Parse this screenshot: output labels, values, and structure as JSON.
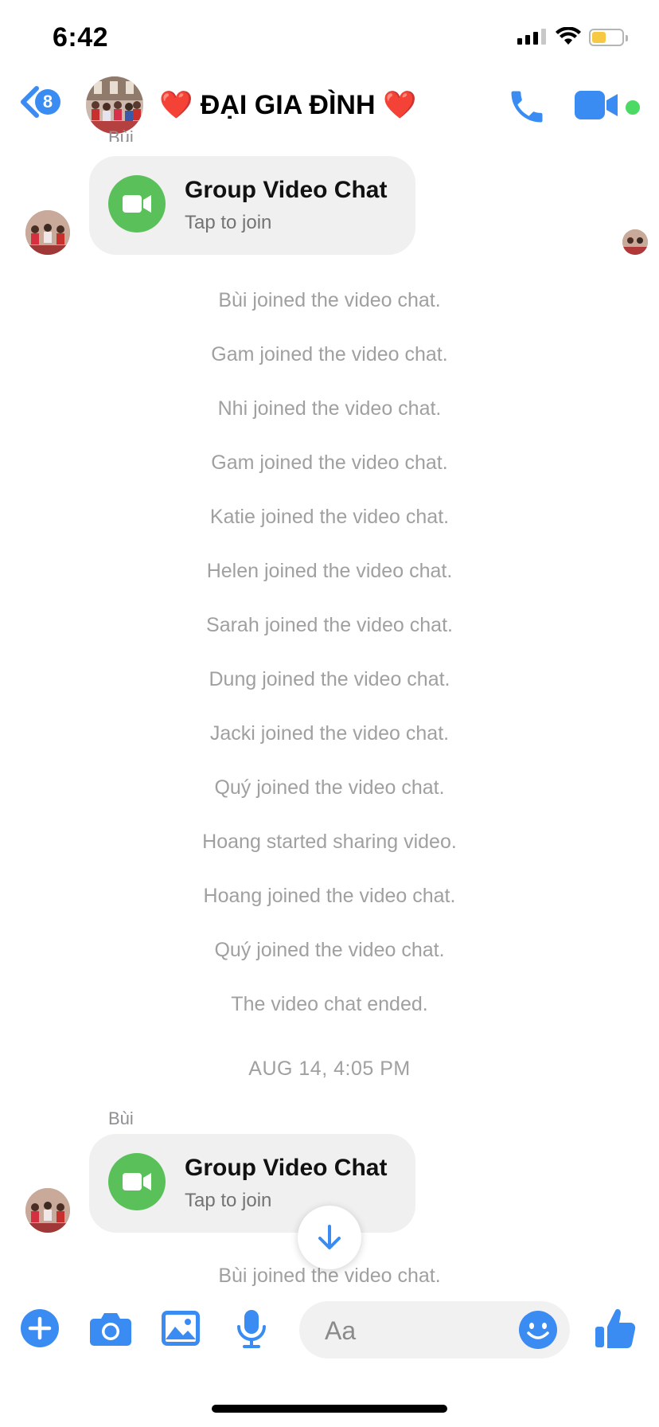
{
  "status_bar": {
    "time": "6:42"
  },
  "header": {
    "unread_count": "8",
    "title_heart_left": "❤️",
    "title": "ĐẠI GIA ĐÌNH",
    "title_heart_right": "❤️",
    "active": true
  },
  "messages": {
    "first_card": {
      "sender": "Bùi",
      "title": "Group Video Chat",
      "subtitle": "Tap to join"
    },
    "system_messages": [
      "Bùi joined the video chat.",
      "Gam joined the video chat.",
      "Nhi joined the video chat.",
      "Gam joined the video chat.",
      "Katie joined the video chat.",
      "Helen joined the video chat.",
      "Sarah joined the video chat.",
      "Dung joined the video chat.",
      "Jacki joined the video chat.",
      "Quý joined the video chat.",
      "Hoang started sharing video.",
      "Hoang joined the video chat.",
      "Quý joined the video chat.",
      "The video chat ended."
    ],
    "date_separator": "AUG 14, 4:05 PM",
    "second_card": {
      "sender": "Bùi",
      "title": "Group Video Chat",
      "subtitle": "Tap to join"
    },
    "last_system_message": "Bùi joined the video chat."
  },
  "composer": {
    "placeholder": "Aa"
  },
  "colors": {
    "accent": "#3a8cf2",
    "video_green": "#5ac05a",
    "active_green": "#4cd964",
    "heart": "#e0202a",
    "system_text": "#a0a0a0"
  },
  "icons": [
    "back-chevron-icon",
    "phone-icon",
    "video-camera-icon",
    "plus-icon",
    "camera-icon",
    "photo-icon",
    "microphone-icon",
    "emoji-icon",
    "thumbs-up-icon",
    "arrow-down-icon"
  ]
}
